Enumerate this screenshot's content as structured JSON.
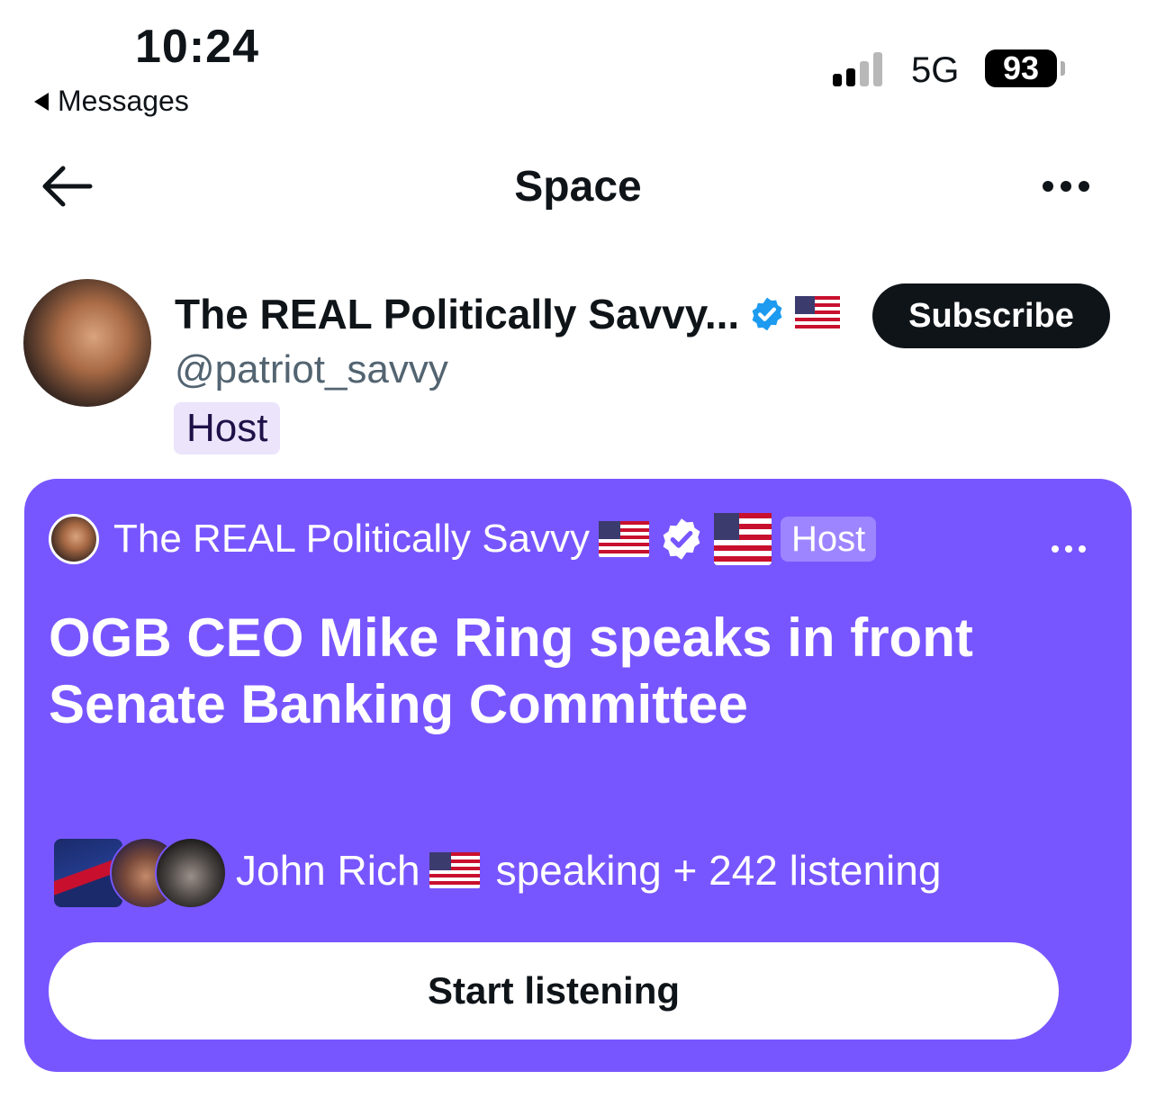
{
  "status_bar": {
    "time": "10:24",
    "back_app": "Messages",
    "network": "5G",
    "battery": "93"
  },
  "nav": {
    "title": "Space",
    "back_icon": "arrow-left-icon",
    "more_icon": "more-horizontal-icon"
  },
  "profile": {
    "name": "The REAL Politically Savvy...",
    "handle": "@patriot_savvy",
    "role": "Host",
    "subscribe_label": "Subscribe",
    "verified_color": "#1d9bf0"
  },
  "space_card": {
    "background": "#7856ff",
    "host_name": "The REAL Politically Savvy",
    "host_tag": "Host",
    "title": "OGB CEO Mike Ring speaks in front Senate Banking Committee",
    "speaker_name": "John Rich",
    "speaking_text": "speaking + 242 listening",
    "start_label": "Start listening"
  }
}
